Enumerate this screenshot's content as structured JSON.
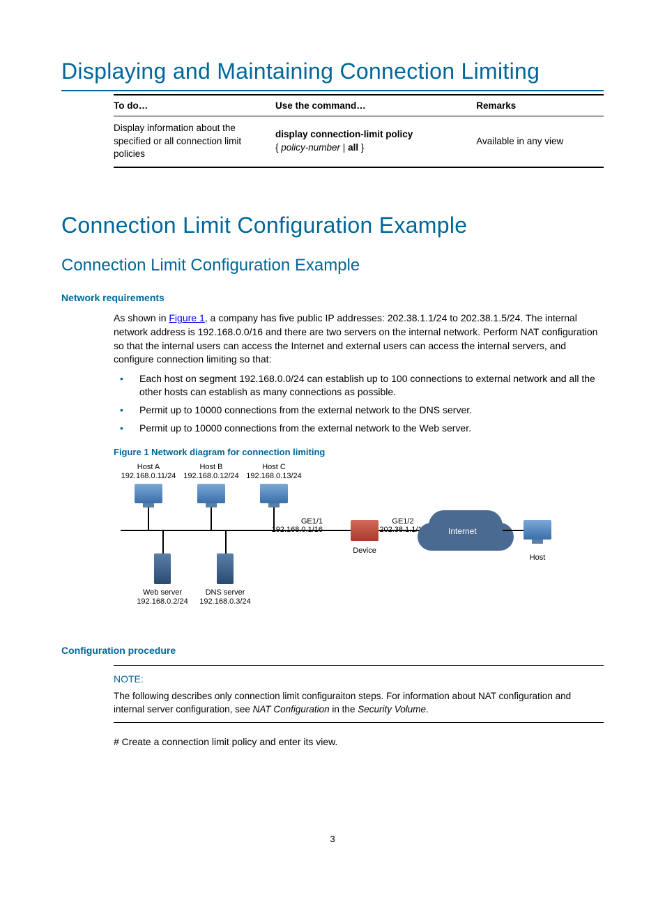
{
  "title1": "Displaying and Maintaining Connection Limiting",
  "table": {
    "headers": [
      "To do…",
      "Use the command…",
      "Remarks"
    ],
    "row": {
      "todo": "Display information about the specified or all connection limit policies",
      "cmd_bold": "display connection-limit policy",
      "cmd_brace_open": "{ ",
      "cmd_italic": "policy-number",
      "cmd_pipe": " | ",
      "cmd_all": "all",
      "cmd_brace_close": " }",
      "remarks": "Available in any view"
    }
  },
  "title2": "Connection Limit Configuration Example",
  "subtitle": "Connection Limit Configuration Example",
  "netreq_heading": "Network requirements",
  "netreq_para_pre": "As shown in ",
  "netreq_link": "Figure 1",
  "netreq_para_post": ", a company has five public IP addresses: 202.38.1.1/24 to 202.38.1.5/24. The internal network address is 192.168.0.0/16 and there are two servers on the internal network. Perform NAT configuration so that the internal users can access the Internet and external users can access the internal servers, and configure connection limiting so that:",
  "bullets": [
    "Each host on segment 192.168.0.0/24 can establish up to 100 connections to external network and all the other hosts can establish as many connections as possible.",
    "Permit up to 10000 connections from the external network to the DNS server.",
    "Permit up to 10000 connections from the external network to the Web server."
  ],
  "fig_caption": "Figure 1 Network diagram for connection limiting",
  "diagram": {
    "hostA": {
      "name": "Host A",
      "ip": "192.168.0.11/24"
    },
    "hostB": {
      "name": "Host B",
      "ip": "192.168.0.12/24"
    },
    "hostC": {
      "name": "Host C",
      "ip": "192.168.0.13/24"
    },
    "ge11": "GE1/1",
    "ge11_ip": "192.168.0.1/16",
    "ge12": "GE1/2",
    "ge12_ip": "202.38.1.1/16",
    "device": "Device",
    "internet": "Internet",
    "host_right": "Host",
    "web": {
      "name": "Web server",
      "ip": "192.168.0.2/24"
    },
    "dns": {
      "name": "DNS server",
      "ip": "192.168.0.3/24"
    }
  },
  "config_heading": "Configuration procedure",
  "note": {
    "label": "NOTE:",
    "text_a": "The following describes only connection limit configuraiton steps. For information about NAT configuration and internal server configuration, see ",
    "ital1": "NAT Configuration",
    "text_b": " in the ",
    "ital2": "Security Volume",
    "text_c": "."
  },
  "step1": "# Create a connection limit policy and enter its view.",
  "page_number": "3"
}
